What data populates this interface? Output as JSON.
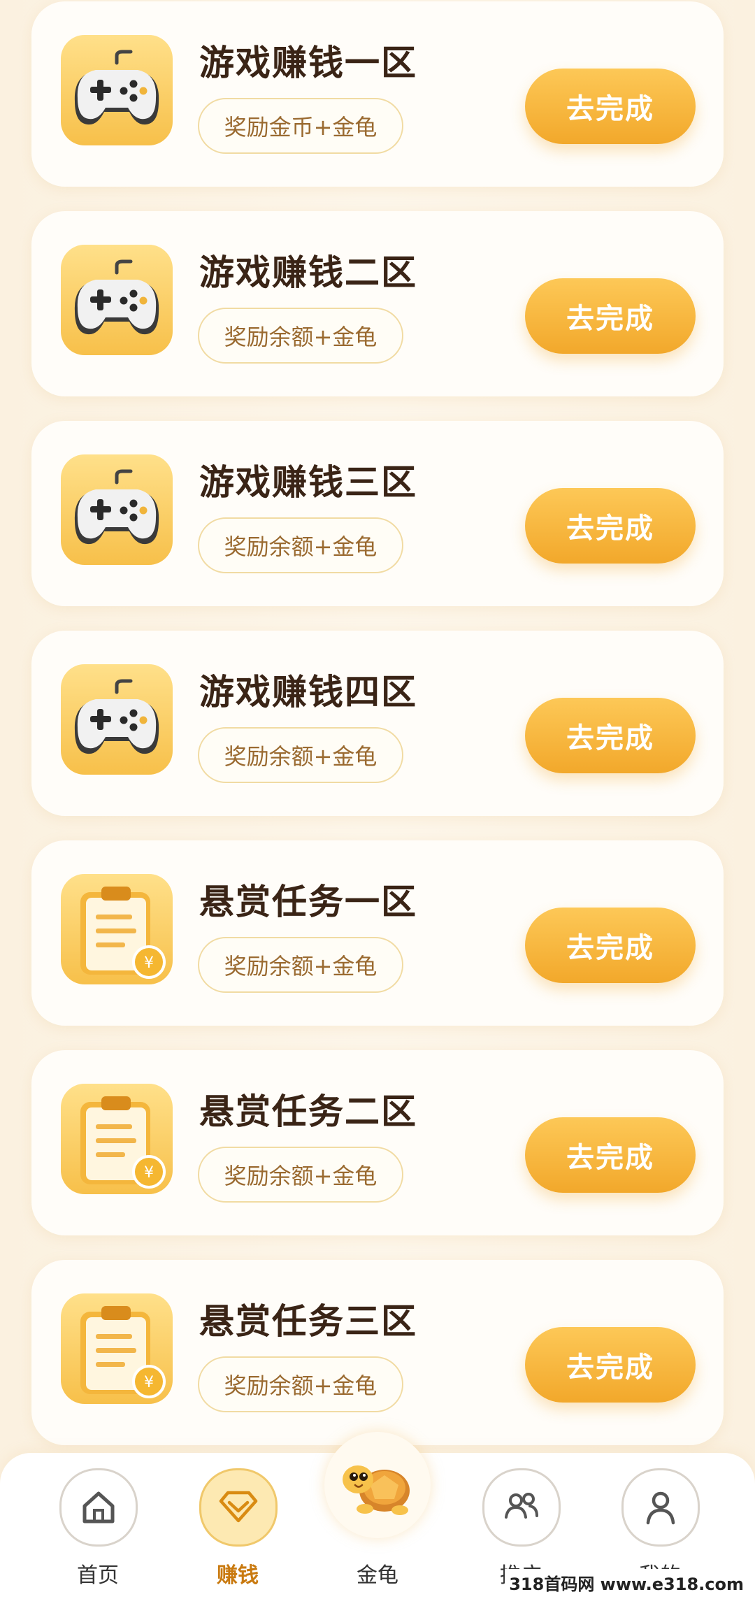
{
  "tasks": [
    {
      "title": "游戏赚钱一区",
      "reward": "奖励金币+金龟",
      "button": "去完成",
      "icon": "gamepad-icon"
    },
    {
      "title": "游戏赚钱二区",
      "reward": "奖励余额+金龟",
      "button": "去完成",
      "icon": "gamepad-icon"
    },
    {
      "title": "游戏赚钱三区",
      "reward": "奖励余额+金龟",
      "button": "去完成",
      "icon": "gamepad-icon"
    },
    {
      "title": "游戏赚钱四区",
      "reward": "奖励余额+金龟",
      "button": "去完成",
      "icon": "gamepad-icon"
    },
    {
      "title": "悬赏任务一区",
      "reward": "奖励余额+金龟",
      "button": "去完成",
      "icon": "clipboard-coin-icon"
    },
    {
      "title": "悬赏任务二区",
      "reward": "奖励余额+金龟",
      "button": "去完成",
      "icon": "clipboard-coin-icon"
    },
    {
      "title": "悬赏任务三区",
      "reward": "奖励余额+金龟",
      "button": "去完成",
      "icon": "clipboard-coin-icon"
    }
  ],
  "nav": {
    "home": {
      "label": "首页",
      "icon": "home-icon"
    },
    "earn": {
      "label": "赚钱",
      "icon": "diamond-icon",
      "active": true
    },
    "turtle": {
      "label": "金龟",
      "icon": "turtle-icon"
    },
    "promote": {
      "label": "推广",
      "icon": "users-icon"
    },
    "mine": {
      "label": "我的",
      "icon": "person-icon"
    }
  },
  "colors": {
    "accent": "#f2a82b",
    "title_text": "#3a2416",
    "reward_text": "#9a6a30",
    "active_nav": "#c97a10"
  },
  "watermark": "318首码网 www.e318.com"
}
